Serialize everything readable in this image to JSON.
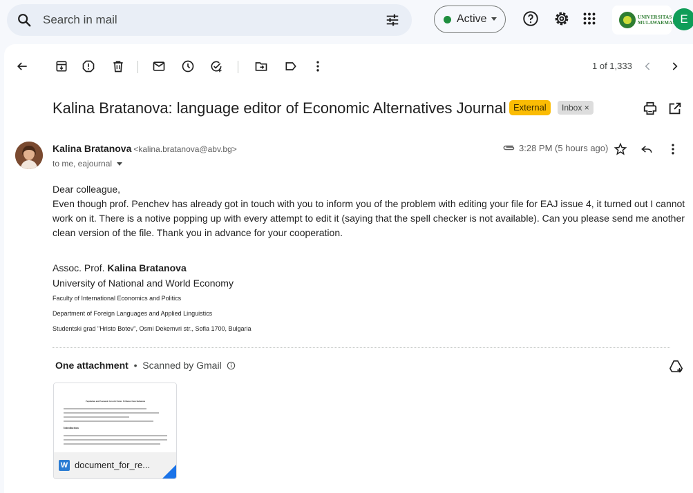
{
  "search": {
    "placeholder": "Search in mail"
  },
  "status": {
    "label": "Active",
    "color": "#1e8e3e"
  },
  "org": {
    "name_line1": "UNIVERSITAS",
    "name_line2": "MULAWARMAN"
  },
  "account": {
    "initial": "E",
    "color": "#0f9d58"
  },
  "toolbar": {
    "icons": [
      "back-arrow-icon",
      "archive-icon",
      "report-spam-icon",
      "delete-icon",
      "mark-unread-icon",
      "snooze-icon",
      "add-task-icon",
      "move-to-icon",
      "label-icon",
      "more-vert-icon"
    ],
    "pager": "1 of 1,333"
  },
  "email": {
    "subject": "Kalina Bratanova: language editor of Economic Alternatives Journal",
    "labels": {
      "external": "External",
      "inbox": "Inbox ×"
    },
    "sender_name": "Kalina Bratanova",
    "sender_email": "<kalina.bratanova@abv.bg>",
    "recipients": "to me, eajournal",
    "time": "3:28 PM (5 hours ago)",
    "greeting": "Dear colleague,",
    "body": "Even though prof. Penchev has already got in touch with you to inform you of the problem with editing your file for EAJ issue 4, it turned out I cannot work on it. There is a notive popping up with every attempt to edit it (saying that the spell checker is not available). Can you please send me another clean version of the file. Thank you in advance for your cooperation.",
    "signature": {
      "title_prefix": "Assoc. Prof. ",
      "name": "Kalina Bratanova",
      "university": "University of National and World Economy",
      "faculty": "Faculty of International Economics and Politics",
      "department": "Department of Foreign Languages and Applied Linguistics",
      "address": "Studentski grad \"Hristo Botev\", Osmi Dekemvri str., Sofia 1700, Bulgaria"
    }
  },
  "attachments": {
    "heading": "One attachment",
    "scanned": "Scanned by Gmail",
    "file_name": "document_for_re...",
    "file_type_letter": "W",
    "preview": {
      "title": "Population and Economic Growth Nexus: Evidence from Indonesia",
      "section": "Introduction"
    }
  }
}
